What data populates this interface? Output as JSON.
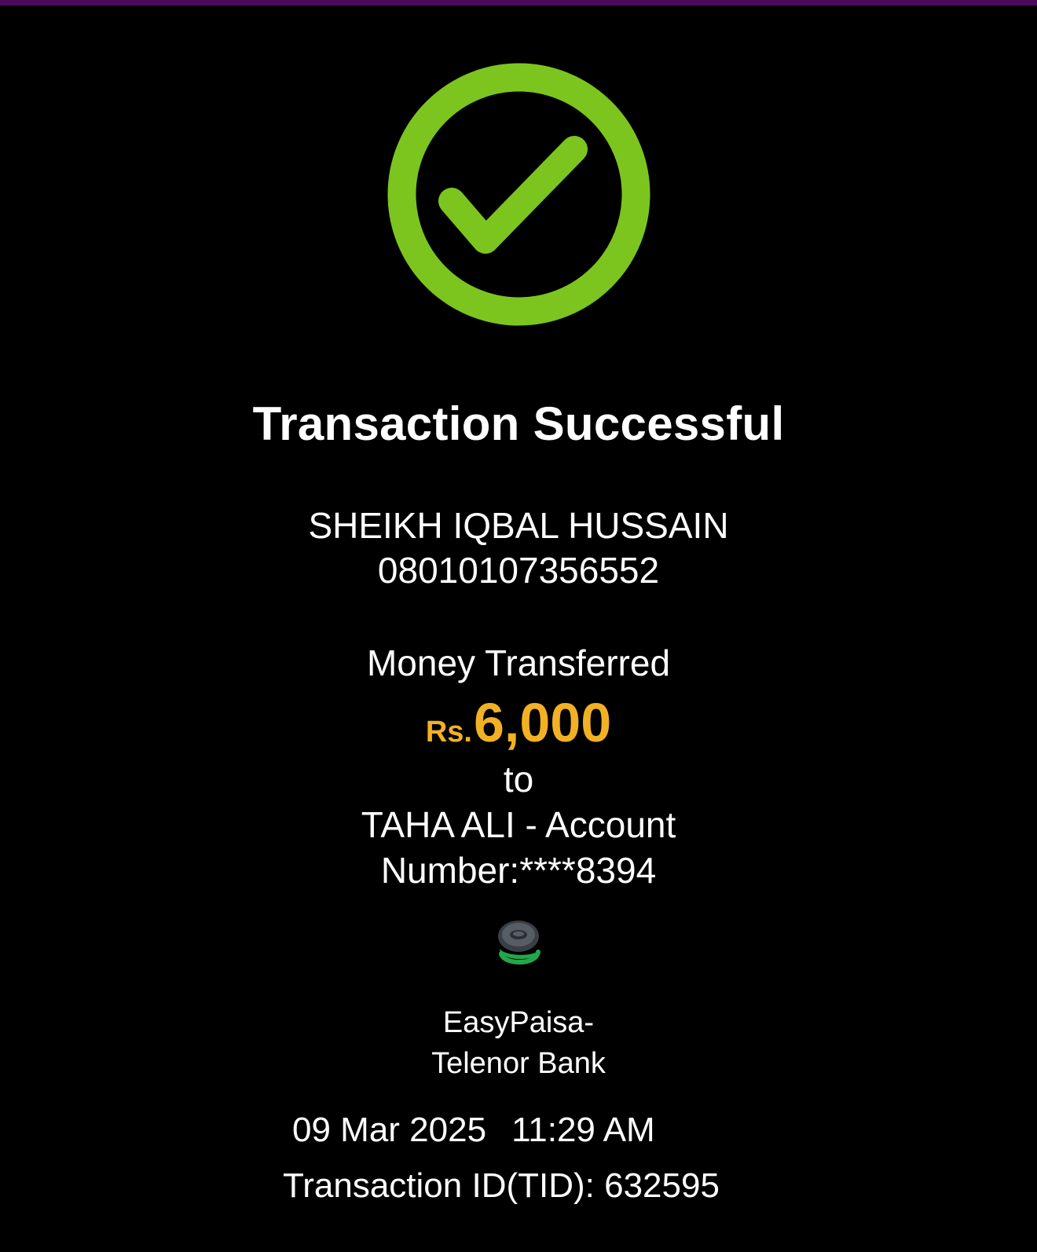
{
  "colors": {
    "background": "#000000",
    "top_bar": "#4a0b5a",
    "success_green": "#7cc51f",
    "amount_orange": "#f2b125",
    "text": "#ffffff"
  },
  "status": {
    "icon": "check-circle-icon",
    "title": "Transaction Successful"
  },
  "sender": {
    "name": "SHEIKH IQBAL HUSSAIN",
    "account": "08010107356552"
  },
  "transfer": {
    "label": "Money Transferred",
    "currency": "Rs.",
    "amount": "6,000",
    "to_label": "to",
    "recipient_line1": "TAHA ALI  - Account",
    "recipient_line2": "Number:****8394"
  },
  "bank": {
    "icon": "easypaisa-logo-icon",
    "line1": "EasyPaisa-",
    "line2": "Telenor Bank"
  },
  "meta": {
    "date": "09 Mar 2025",
    "time": "11:29 AM",
    "tid": "Transaction ID(TID): 632595"
  }
}
